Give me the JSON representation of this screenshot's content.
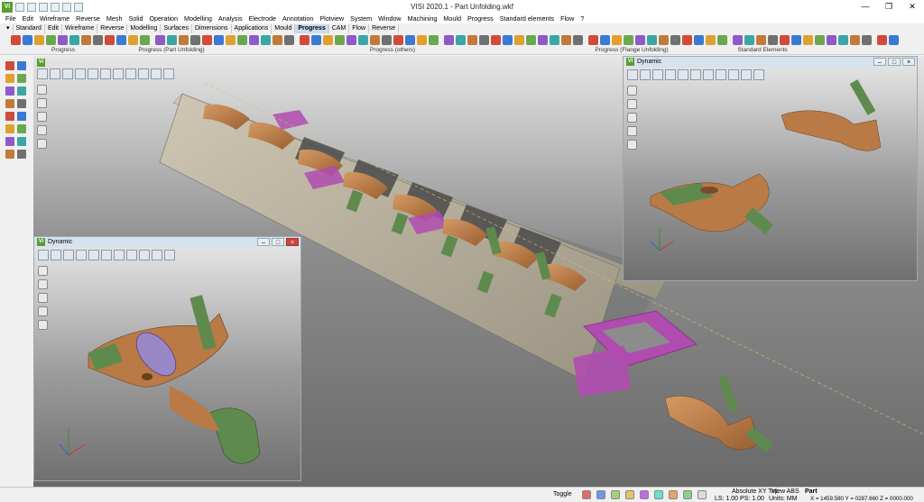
{
  "window": {
    "title": "VISI 2020.1 - Part Unfolding.wkf",
    "logo": "Vi",
    "controls": {
      "minimize": "—",
      "maximize": "❐",
      "close": "✕"
    }
  },
  "menu": [
    "File",
    "Edit",
    "Wireframe",
    "Reverse",
    "Mesh",
    "Solid",
    "Operation",
    "Modelling",
    "Analysis",
    "Electrode",
    "Annotation",
    "Plotview",
    "System",
    "Window",
    "Machining",
    "Mould",
    "Progress",
    "Standard elements",
    "Flow",
    "?"
  ],
  "tabs": [
    "Standard",
    "Edit",
    "Wireframe",
    "Reverse",
    "Modelling",
    "Surfaces",
    "Dimensions",
    "Applications",
    "Mould",
    "Progress",
    "CAM",
    "Flow",
    "Reverse"
  ],
  "active_tab": "Progress",
  "toolbar_groups": [
    "Progress",
    "Progress (Part Unfolding)",
    "Progress (others)",
    "Progress (Flange Unfolding)",
    "Standard Elements"
  ],
  "viewport": {
    "label": "Dynamic",
    "logo": "Vi"
  },
  "floating_windows": [
    {
      "title": "Dynamic",
      "logo": "Vi"
    },
    {
      "title": "Dynamic",
      "logo": "Vi"
    }
  ],
  "status": {
    "toggle": "Toggle",
    "view_mode": "Absolute XY Top",
    "view_abs": "View ABS",
    "part": "Part",
    "ls_ps": "LS: 1.00 PS: 1.00",
    "units": "Units: MM",
    "coords": "X = 1459.580 Y = 0287.660 Z = 0000.000"
  },
  "colors": {
    "part": "#b97a45",
    "flange": "#5e8a4e",
    "pink": "#b04cb0",
    "accent": "#5a9e2f"
  }
}
